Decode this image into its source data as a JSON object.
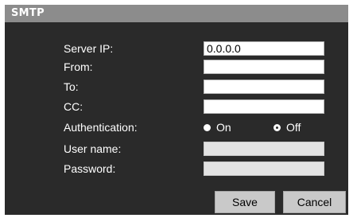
{
  "header": {
    "title": "SMTP"
  },
  "form": {
    "server_ip": {
      "label": "Server IP:",
      "value": "0.0.0.0"
    },
    "from": {
      "label": "From:",
      "value": ""
    },
    "to": {
      "label": "To:",
      "value": ""
    },
    "cc": {
      "label": "CC:",
      "value": ""
    },
    "authentication": {
      "label": "Authentication:",
      "options": [
        {
          "label": "On",
          "selected": false
        },
        {
          "label": "Off",
          "selected": true
        }
      ]
    },
    "user_name": {
      "label": "User name:",
      "value": ""
    },
    "password": {
      "label": "Password:",
      "value": ""
    }
  },
  "buttons": {
    "save": "Save",
    "cancel": "Cancel"
  }
}
